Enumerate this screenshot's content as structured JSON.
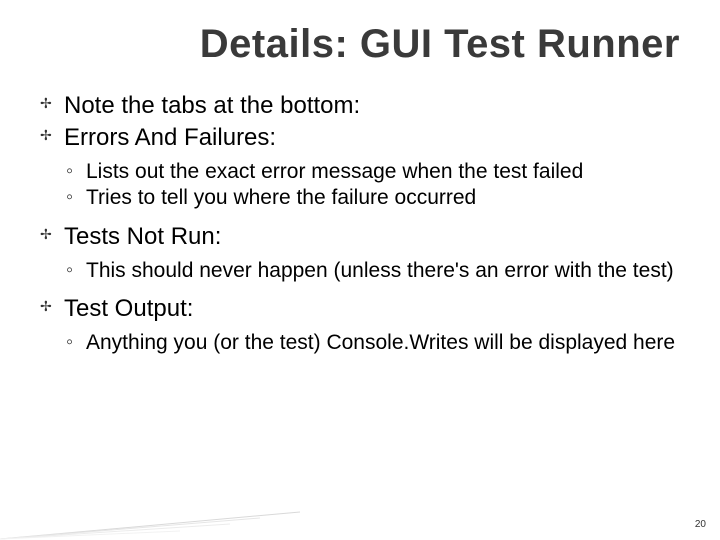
{
  "title": "Details: GUI Test Runner",
  "bullets": {
    "b1": "Note the tabs at the bottom:",
    "b2": "Errors And Failures:",
    "b2_subs": {
      "s1": "Lists out the exact error message when the test failed",
      "s2": "Tries to tell you where the failure occurred"
    },
    "b3": "Tests Not Run:",
    "b3_subs": {
      "s1": "This should never happen (unless there's an error with the test)"
    },
    "b4": "Test Output:",
    "b4_subs": {
      "s1": "Anything you (or the test) Console.Writes will be displayed here"
    }
  },
  "page_number": "20"
}
